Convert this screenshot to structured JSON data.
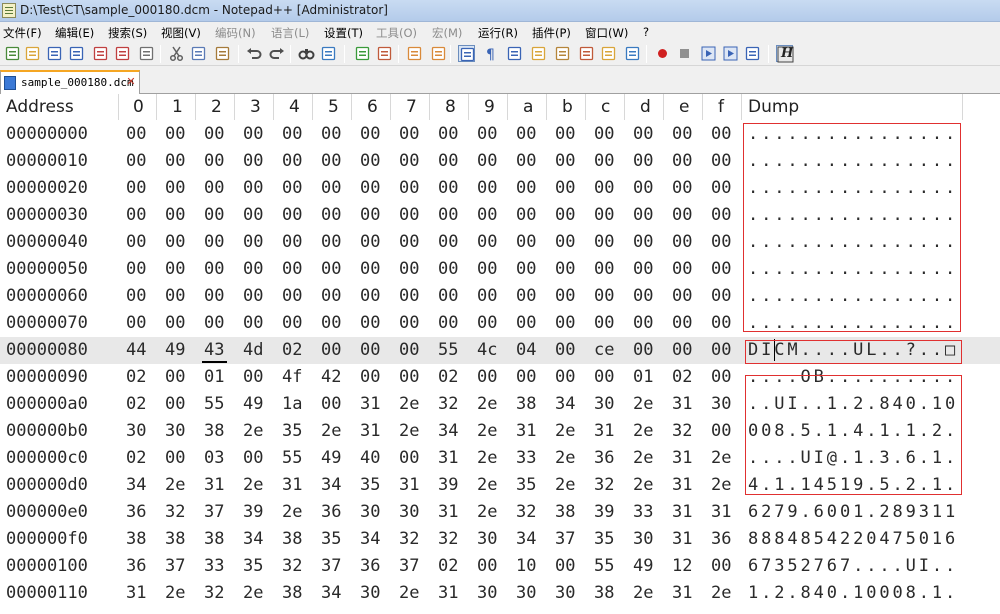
{
  "window": {
    "title": "D:\\Test\\CT\\sample_000180.dcm - Notepad++ [Administrator]"
  },
  "menu": [
    {
      "label": "文件(F)",
      "enabled": true
    },
    {
      "label": "编辑(E)",
      "enabled": true
    },
    {
      "label": "搜索(S)",
      "enabled": true
    },
    {
      "label": "视图(V)",
      "enabled": true
    },
    {
      "label": "编码(N)",
      "enabled": false
    },
    {
      "label": "语言(L)",
      "enabled": false
    },
    {
      "label": "设置(T)",
      "enabled": true
    },
    {
      "label": "工具(O)",
      "enabled": false
    },
    {
      "label": "宏(M)",
      "enabled": false
    },
    {
      "label": "运行(R)",
      "enabled": true
    },
    {
      "label": "插件(P)",
      "enabled": true
    },
    {
      "label": "窗口(W)",
      "enabled": true
    },
    {
      "label": "?",
      "enabled": true
    }
  ],
  "toolbar": {
    "icons": [
      "new-file-icon",
      "open-file-icon",
      "save-icon",
      "save-all-icon",
      "close-icon",
      "close-all-icon",
      "print-icon",
      "cut-icon",
      "copy-icon",
      "paste-icon",
      "undo-icon",
      "redo-icon",
      "find-icon",
      "replace-icon",
      "zoom-in-icon",
      "zoom-out-icon",
      "sync-vertical-icon",
      "sync-horizontal-icon",
      "word-wrap-icon",
      "show-all-chars-icon",
      "indent-guide-icon",
      "user-lang-icon",
      "doc-map-icon",
      "function-list-icon",
      "folder-workspace-icon",
      "monitor-icon",
      "record-macro-icon",
      "stop-macro-icon",
      "play-macro-icon",
      "run-macro-multiple-icon",
      "save-macro-icon",
      "hex-editor-icon"
    ],
    "hex_button_label": "H"
  },
  "tab": {
    "label": "sample_000180.dcm"
  },
  "hex": {
    "header": {
      "address": "Address",
      "columns": [
        "0",
        "1",
        "2",
        "3",
        "4",
        "5",
        "6",
        "7",
        "8",
        "9",
        "a",
        "b",
        "c",
        "d",
        "e",
        "f"
      ],
      "dump": "Dump"
    },
    "current_row": 8,
    "rows": [
      {
        "addr": "00000000",
        "bytes": [
          "00",
          "00",
          "00",
          "00",
          "00",
          "00",
          "00",
          "00",
          "00",
          "00",
          "00",
          "00",
          "00",
          "00",
          "00",
          "00"
        ],
        "dump": "................"
      },
      {
        "addr": "00000010",
        "bytes": [
          "00",
          "00",
          "00",
          "00",
          "00",
          "00",
          "00",
          "00",
          "00",
          "00",
          "00",
          "00",
          "00",
          "00",
          "00",
          "00"
        ],
        "dump": "................"
      },
      {
        "addr": "00000020",
        "bytes": [
          "00",
          "00",
          "00",
          "00",
          "00",
          "00",
          "00",
          "00",
          "00",
          "00",
          "00",
          "00",
          "00",
          "00",
          "00",
          "00"
        ],
        "dump": "................"
      },
      {
        "addr": "00000030",
        "bytes": [
          "00",
          "00",
          "00",
          "00",
          "00",
          "00",
          "00",
          "00",
          "00",
          "00",
          "00",
          "00",
          "00",
          "00",
          "00",
          "00"
        ],
        "dump": "................"
      },
      {
        "addr": "00000040",
        "bytes": [
          "00",
          "00",
          "00",
          "00",
          "00",
          "00",
          "00",
          "00",
          "00",
          "00",
          "00",
          "00",
          "00",
          "00",
          "00",
          "00"
        ],
        "dump": "................"
      },
      {
        "addr": "00000050",
        "bytes": [
          "00",
          "00",
          "00",
          "00",
          "00",
          "00",
          "00",
          "00",
          "00",
          "00",
          "00",
          "00",
          "00",
          "00",
          "00",
          "00"
        ],
        "dump": "................"
      },
      {
        "addr": "00000060",
        "bytes": [
          "00",
          "00",
          "00",
          "00",
          "00",
          "00",
          "00",
          "00",
          "00",
          "00",
          "00",
          "00",
          "00",
          "00",
          "00",
          "00"
        ],
        "dump": "................"
      },
      {
        "addr": "00000070",
        "bytes": [
          "00",
          "00",
          "00",
          "00",
          "00",
          "00",
          "00",
          "00",
          "00",
          "00",
          "00",
          "00",
          "00",
          "00",
          "00",
          "00"
        ],
        "dump": "................"
      },
      {
        "addr": "00000080",
        "bytes": [
          "44",
          "49",
          "43",
          "4d",
          "02",
          "00",
          "00",
          "00",
          "55",
          "4c",
          "04",
          "00",
          "ce",
          "00",
          "00",
          "00"
        ],
        "dump": "DICM....UL..?..□"
      },
      {
        "addr": "00000090",
        "bytes": [
          "02",
          "00",
          "01",
          "00",
          "4f",
          "42",
          "00",
          "00",
          "02",
          "00",
          "00",
          "00",
          "00",
          "01",
          "02",
          "00"
        ],
        "dump": "....OB.........."
      },
      {
        "addr": "000000a0",
        "bytes": [
          "02",
          "00",
          "55",
          "49",
          "1a",
          "00",
          "31",
          "2e",
          "32",
          "2e",
          "38",
          "34",
          "30",
          "2e",
          "31",
          "30"
        ],
        "dump": "..UI..1.2.840.10"
      },
      {
        "addr": "000000b0",
        "bytes": [
          "30",
          "30",
          "38",
          "2e",
          "35",
          "2e",
          "31",
          "2e",
          "34",
          "2e",
          "31",
          "2e",
          "31",
          "2e",
          "32",
          "00"
        ],
        "dump": "008.5.1.4.1.1.2."
      },
      {
        "addr": "000000c0",
        "bytes": [
          "02",
          "00",
          "03",
          "00",
          "55",
          "49",
          "40",
          "00",
          "31",
          "2e",
          "33",
          "2e",
          "36",
          "2e",
          "31",
          "2e"
        ],
        "dump": "....UI@.1.3.6.1."
      },
      {
        "addr": "000000d0",
        "bytes": [
          "34",
          "2e",
          "31",
          "2e",
          "31",
          "34",
          "35",
          "31",
          "39",
          "2e",
          "35",
          "2e",
          "32",
          "2e",
          "31",
          "2e"
        ],
        "dump": "4.1.14519.5.2.1."
      },
      {
        "addr": "000000e0",
        "bytes": [
          "36",
          "32",
          "37",
          "39",
          "2e",
          "36",
          "30",
          "30",
          "31",
          "2e",
          "32",
          "38",
          "39",
          "33",
          "31",
          "31"
        ],
        "dump": "6279.6001.289311"
      },
      {
        "addr": "000000f0",
        "bytes": [
          "38",
          "38",
          "38",
          "34",
          "38",
          "35",
          "34",
          "32",
          "32",
          "30",
          "34",
          "37",
          "35",
          "30",
          "31",
          "36"
        ],
        "dump": "8884854220475016"
      },
      {
        "addr": "00000100",
        "bytes": [
          "36",
          "37",
          "33",
          "35",
          "32",
          "37",
          "36",
          "37",
          "02",
          "00",
          "10",
          "00",
          "55",
          "49",
          "12",
          "00"
        ],
        "dump": "67352767....UI.."
      },
      {
        "addr": "00000110",
        "bytes": [
          "31",
          "2e",
          "32",
          "2e",
          "38",
          "34",
          "30",
          "2e",
          "31",
          "30",
          "30",
          "30",
          "38",
          "2e",
          "31",
          "2e"
        ],
        "dump": "1.2.840.10008.1."
      }
    ]
  }
}
